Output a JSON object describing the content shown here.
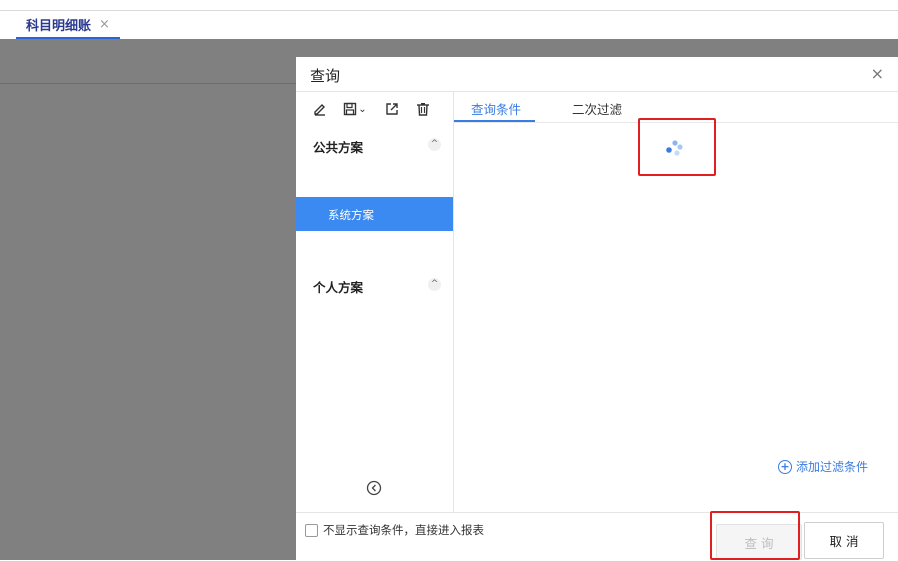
{
  "tabs": [
    {
      "label": "科目明细账",
      "close_icon": "×"
    }
  ],
  "dialog": {
    "title": "查询",
    "close_icon": "×",
    "toolbar": {
      "icons": [
        "edit-icon",
        "save-icon",
        "export-icon",
        "delete-icon"
      ],
      "save_dropdown": "⌄"
    },
    "schemes": {
      "public_label": "公共方案",
      "public_items": [
        "系统方案"
      ],
      "personal_label": "个人方案",
      "chevron": "^"
    },
    "tabs": [
      {
        "label": "查询条件",
        "active": true
      },
      {
        "label": "二次过滤",
        "active": false
      }
    ],
    "add_filter_label": "添加过滤条件",
    "checkbox_label": "不显示查询条件，直接进入报表",
    "query_button": "查 询",
    "cancel_button": "取 消"
  },
  "colors": {
    "accent": "#3a7ce0",
    "selected_item": "#3a8af2",
    "overlay": "#808080",
    "highlight_box": "#e02020"
  }
}
